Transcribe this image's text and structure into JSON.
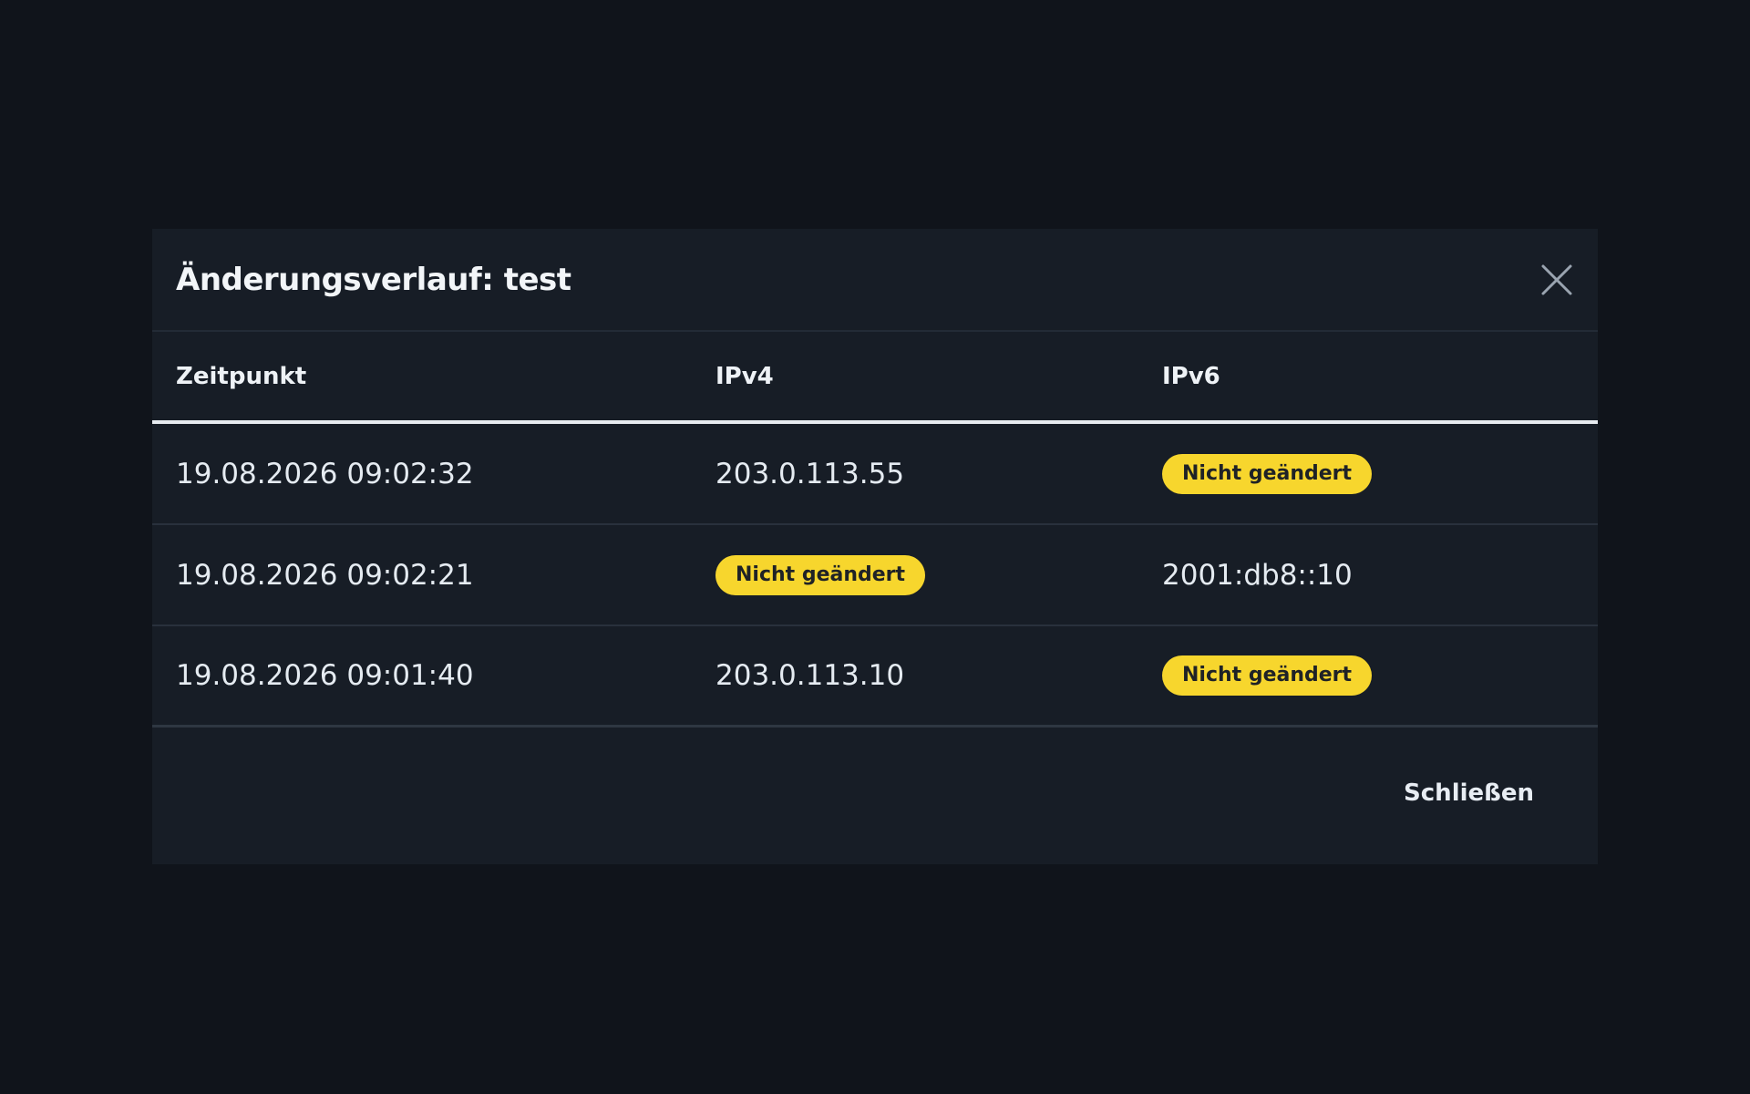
{
  "dialog": {
    "title": "Änderungsverlauf: test",
    "close_icon": "close-icon",
    "footer_button": "Schließen"
  },
  "table": {
    "headers": [
      "Zeitpunkt",
      "IPv4",
      "IPv6"
    ],
    "rows": [
      {
        "time": "19.08.2026 09:02:32",
        "ipv4": "203.0.113.55",
        "ipv6": "Nicht geändert"
      },
      {
        "time": "19.08.2026 09:02:21",
        "ipv4": "Nicht geändert",
        "ipv6": "2001:db8::10"
      },
      {
        "time": "19.08.2026 09:01:40",
        "ipv4": "203.0.113.10",
        "ipv6": "Nicht geändert"
      }
    ]
  },
  "colors": {
    "page_bg": "#10141b",
    "modal_bg": "#171d26",
    "badge_bg": "#f7d62d",
    "badge_text": "#1f2226"
  }
}
